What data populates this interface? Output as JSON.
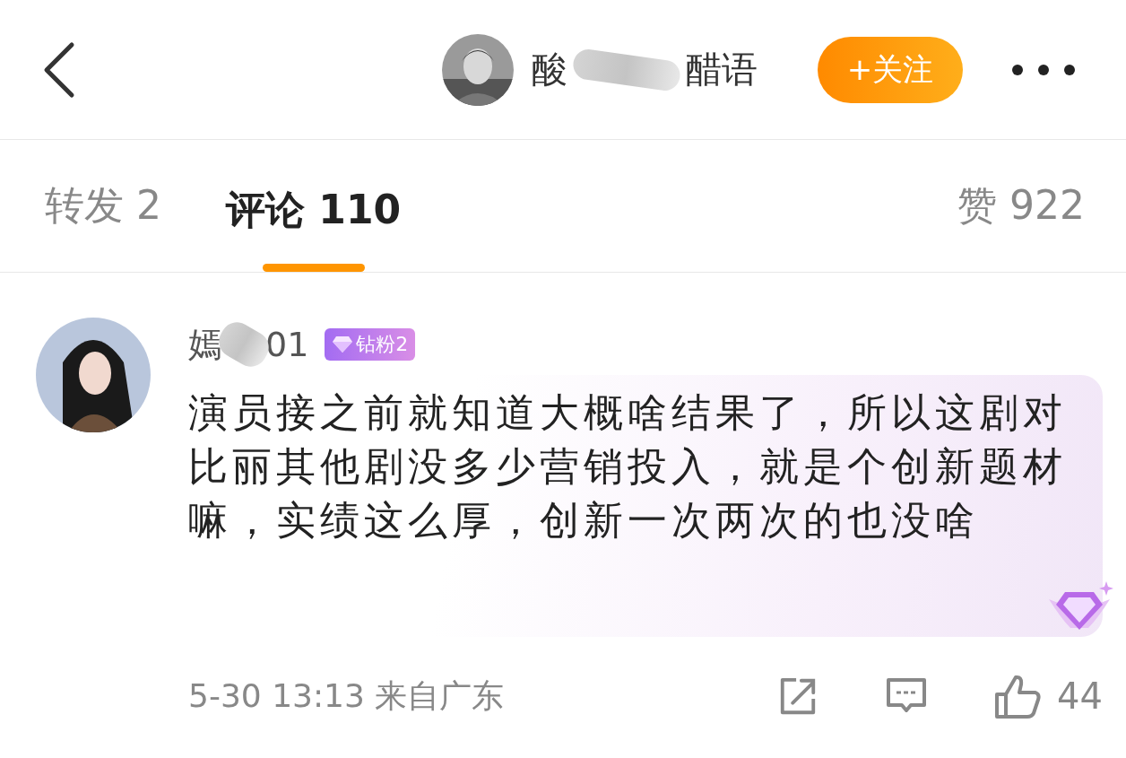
{
  "header": {
    "title_start": "酸",
    "title_end": "醋语",
    "follow_button": "+关注"
  },
  "tabs": [
    {
      "label": "转发 2",
      "selected": false
    },
    {
      "label": "评论 110",
      "selected": true
    }
  ],
  "likes_tab": "赞 922",
  "comment": {
    "user_start": "嫣",
    "user_end": "01",
    "badge": "钻粉2",
    "text": "演员接之前就知道大概啥结果了，所以这剧对比丽其他剧没多少营销投入，就是个创新题材嘛，实绩这么厚，创新一次两次的也没啥",
    "meta": "5-30 13:13 来自广东",
    "like_count": "44"
  }
}
